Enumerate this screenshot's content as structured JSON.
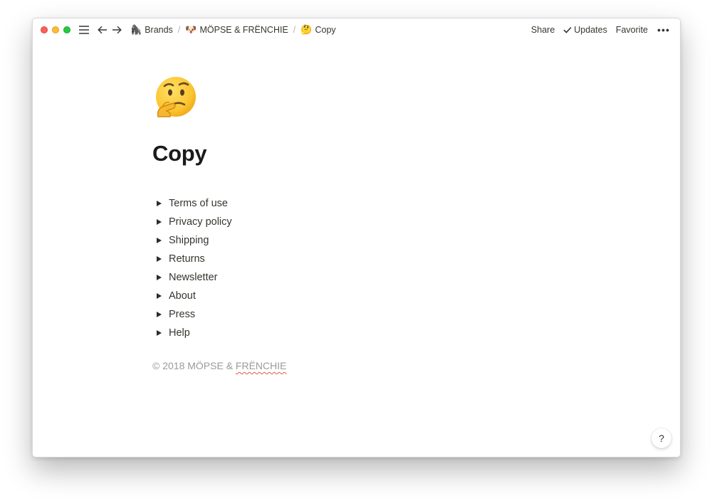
{
  "titlebar": {
    "breadcrumbs": [
      {
        "emoji": "🦍",
        "label": "Brands"
      },
      {
        "emoji": "🐶",
        "label": "MÖPSE & FRËNCHIE"
      },
      {
        "emoji": "🤔",
        "label": "Copy"
      }
    ],
    "separator": "/",
    "share_label": "Share",
    "updates_label": "Updates",
    "favorite_label": "Favorite"
  },
  "page": {
    "title": "Copy",
    "icon": "thinking-face-icon",
    "toggles": [
      {
        "label": "Terms of use"
      },
      {
        "label": "Privacy policy"
      },
      {
        "label": "Shipping"
      },
      {
        "label": "Returns"
      },
      {
        "label": "Newsletter"
      },
      {
        "label": "About"
      },
      {
        "label": "Press"
      },
      {
        "label": "Help"
      }
    ],
    "footer_prefix": "© 2018 MÖPSE & ",
    "footer_brand": "FRËNCHIE"
  },
  "help_label": "?",
  "colors": {
    "close": "#fe5f57",
    "minimize": "#febc2e",
    "zoom": "#28c840",
    "text": "#37352f",
    "muted": "#9b9a97"
  }
}
